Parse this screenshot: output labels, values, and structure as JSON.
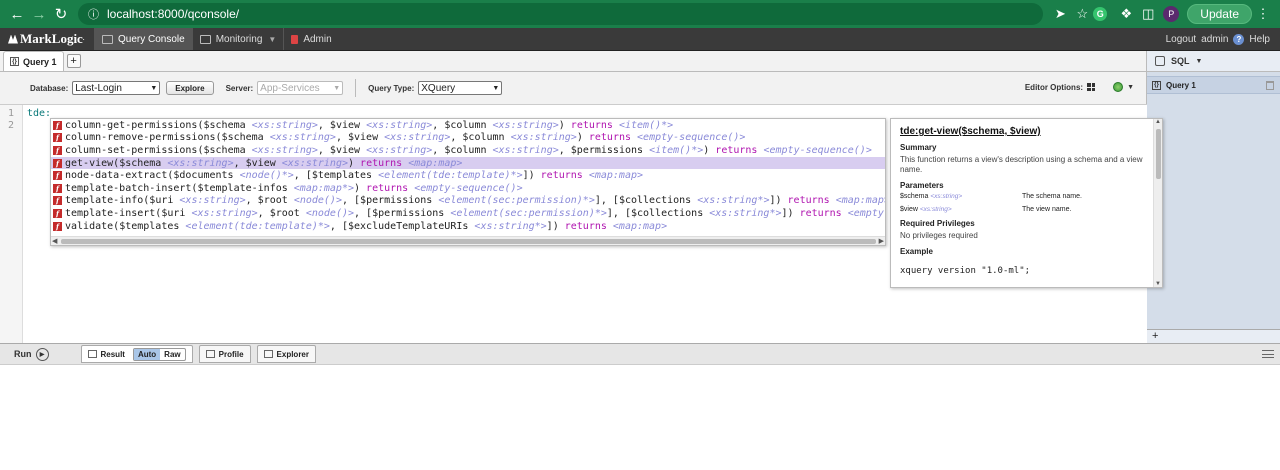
{
  "browser": {
    "url": "localhost:8000/qconsole/",
    "update_label": "Update",
    "profile_initial": "P",
    "ext_initial": "G"
  },
  "appbar": {
    "logo": "MarkLogic",
    "tabs": [
      {
        "label": "Query Console",
        "icon": "console-icon"
      },
      {
        "label": "Monitoring",
        "icon": "monitor-icon"
      },
      {
        "label": "Admin",
        "icon": "admin-icon"
      }
    ],
    "logout_label": "Logout",
    "user": "admin",
    "help_label": "Help"
  },
  "query_tabs": {
    "tabs": [
      "Query 1"
    ],
    "add_label": "+"
  },
  "toolbar": {
    "database_label": "Database:",
    "database_value": "Last-Login",
    "explore_label": "Explore",
    "server_label": "Server:",
    "server_value": "App-Services",
    "query_type_label": "Query Type:",
    "query_type_value": "XQuery",
    "editor_options_label": "Editor Options:"
  },
  "editor": {
    "line_numbers": [
      "1",
      "2"
    ],
    "code_line": "tde:"
  },
  "autocomplete": {
    "items": [
      {
        "name": "column-get-permissions(",
        "parts": [
          [
            "$schema ",
            "n"
          ],
          [
            "<xs:string>",
            "t"
          ],
          [
            ", $view ",
            "n"
          ],
          [
            "<xs:string>",
            "t"
          ],
          [
            ", $column ",
            "n"
          ],
          [
            "<xs:string>",
            "t"
          ],
          [
            ") ",
            "n"
          ],
          [
            "returns ",
            "k"
          ],
          [
            "<item()*>",
            "t"
          ]
        ]
      },
      {
        "name": "column-remove-permissions(",
        "parts": [
          [
            "$schema ",
            "n"
          ],
          [
            "<xs:string>",
            "t"
          ],
          [
            ", $view ",
            "n"
          ],
          [
            "<xs:string>",
            "t"
          ],
          [
            ", $column ",
            "n"
          ],
          [
            "<xs:string>",
            "t"
          ],
          [
            ") ",
            "n"
          ],
          [
            "returns ",
            "k"
          ],
          [
            "<empty-sequence()>",
            "t"
          ]
        ]
      },
      {
        "name": "column-set-permissions(",
        "parts": [
          [
            "$schema ",
            "n"
          ],
          [
            "<xs:string>",
            "t"
          ],
          [
            ", $view ",
            "n"
          ],
          [
            "<xs:string>",
            "t"
          ],
          [
            ", $column ",
            "n"
          ],
          [
            "<xs:string>",
            "t"
          ],
          [
            ", $permissions ",
            "n"
          ],
          [
            "<item()*>",
            "t"
          ],
          [
            ") ",
            "n"
          ],
          [
            "returns ",
            "k"
          ],
          [
            "<empty-sequence()>",
            "t"
          ]
        ]
      },
      {
        "name": "get-view(",
        "selected": true,
        "parts": [
          [
            "$schema ",
            "n"
          ],
          [
            "<xs:string>",
            "t"
          ],
          [
            ", $view ",
            "n"
          ],
          [
            "<xs:string>",
            "t"
          ],
          [
            ") ",
            "n"
          ],
          [
            "returns ",
            "k"
          ],
          [
            "<map:map>",
            "t"
          ]
        ]
      },
      {
        "name": "node-data-extract(",
        "parts": [
          [
            "$documents ",
            "n"
          ],
          [
            "<node()*>",
            "t"
          ],
          [
            ", [$templates ",
            "n"
          ],
          [
            "<element(tde:template)*>",
            "t"
          ],
          [
            "]) ",
            "n"
          ],
          [
            "returns ",
            "k"
          ],
          [
            "<map:map>",
            "t"
          ]
        ]
      },
      {
        "name": "template-batch-insert(",
        "parts": [
          [
            "$template-infos ",
            "n"
          ],
          [
            "<map:map*>",
            "t"
          ],
          [
            ") ",
            "n"
          ],
          [
            "returns ",
            "k"
          ],
          [
            "<empty-sequence()>",
            "t"
          ]
        ]
      },
      {
        "name": "template-info(",
        "parts": [
          [
            "$uri ",
            "n"
          ],
          [
            "<xs:string>",
            "t"
          ],
          [
            ", $root ",
            "n"
          ],
          [
            "<node()>",
            "t"
          ],
          [
            ", [$permissions ",
            "n"
          ],
          [
            "<element(sec:permission)*>",
            "t"
          ],
          [
            "], [$collections ",
            "n"
          ],
          [
            "<xs:string*>",
            "t"
          ],
          [
            "]) ",
            "n"
          ],
          [
            "returns ",
            "k"
          ],
          [
            "<map:map>",
            "t"
          ]
        ]
      },
      {
        "name": "template-insert(",
        "parts": [
          [
            "$uri ",
            "n"
          ],
          [
            "<xs:string>",
            "t"
          ],
          [
            ", $root ",
            "n"
          ],
          [
            "<node()>",
            "t"
          ],
          [
            ", [$permissions ",
            "n"
          ],
          [
            "<element(sec:permission)*>",
            "t"
          ],
          [
            "], [$collections ",
            "n"
          ],
          [
            "<xs:string*>",
            "t"
          ],
          [
            "]) ",
            "n"
          ],
          [
            "returns ",
            "k"
          ],
          [
            "<empty-sequence(",
            "t"
          ]
        ]
      },
      {
        "name": "validate(",
        "parts": [
          [
            "$templates ",
            "n"
          ],
          [
            "<element(tde:template)*>",
            "t"
          ],
          [
            ", [$excludeTemplateURIs ",
            "n"
          ],
          [
            "<xs:string*>",
            "t"
          ],
          [
            "]) ",
            "n"
          ],
          [
            "returns ",
            "k"
          ],
          [
            "<map:map>",
            "t"
          ]
        ]
      }
    ]
  },
  "doc": {
    "title": "tde:get-view($schema, $view)",
    "summary_heading": "Summary",
    "summary": "This function returns a view's description using a schema and a view name.",
    "params_heading": "Parameters",
    "params": [
      {
        "name": "$schema",
        "type": "<xs:string>",
        "desc": "The schema name."
      },
      {
        "name": "$view",
        "type": "<xs:string>",
        "desc": "The view name."
      }
    ],
    "privileges_heading": "Required Privileges",
    "privileges": "No privileges required",
    "example_heading": "Example",
    "example": "xquery version \"1.0-ml\";"
  },
  "right_panel": {
    "header": "SQL",
    "items": [
      "Query 1"
    ],
    "add_label": "+"
  },
  "resultbar": {
    "run_label": "Run",
    "result_label": "Result",
    "auto_label": "Auto",
    "raw_label": "Raw",
    "profile_label": "Profile",
    "explorer_label": "Explorer"
  },
  "colors": {
    "browser_bg": "#1a7f4a",
    "appbar_bg": "#3a3a3a",
    "selected_row": "#d8cdf0",
    "keyword": "#b016b0",
    "type": "#8a8ad8"
  }
}
